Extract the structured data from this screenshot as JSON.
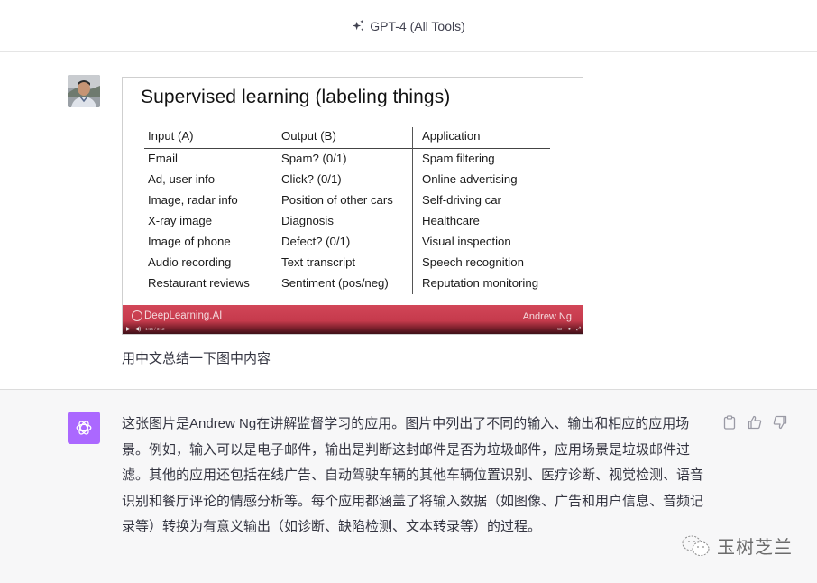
{
  "header": {
    "model_label": "GPT-4 (All Tools)"
  },
  "user_message": {
    "slide": {
      "title": "Supervised learning (labeling things)",
      "columns": {
        "input_header": "Input (A)",
        "output_header": "Output (B)",
        "application_header": "Application"
      },
      "rows": [
        {
          "input": "Email",
          "output": "Spam? (0/1)",
          "application": "Spam filtering"
        },
        {
          "input": "Ad, user info",
          "output": "Click? (0/1)",
          "application": "Online advertising"
        },
        {
          "input": "Image, radar info",
          "output": "Position of other cars",
          "application": "Self-driving car"
        },
        {
          "input": "X-ray image",
          "output": "Diagnosis",
          "application": "Healthcare"
        },
        {
          "input": "Image of phone",
          "output": "Defect? (0/1)",
          "application": "Visual inspection"
        },
        {
          "input": "Audio recording",
          "output": "Text transcript",
          "application": "Speech recognition"
        },
        {
          "input": "Restaurant reviews",
          "output": "Sentiment (pos/neg)",
          "application": "Reputation monitoring"
        }
      ],
      "footer_brand": "DeepLearning.AI",
      "footer_presenter": "Andrew Ng",
      "player_time": "1:15 / 3:12"
    },
    "prompt": "用中文总结一下图中内容"
  },
  "assistant_message": {
    "text": "这张图片是Andrew Ng在讲解监督学习的应用。图片中列出了不同的输入、输出和相应的应用场景。例如，输入可以是电子邮件，输出是判断这封邮件是否为垃圾邮件，应用场景是垃圾邮件过滤。其他的应用还包括在线广告、自动驾驶车辆的其他车辆位置识别、医疗诊断、视觉检测、语音识别和餐厅评论的情感分析等。每个应用都涵盖了将输入数据（如图像、广告和用户信息、音频记录等）转换为有意义输出（如诊断、缺陷检测、文本转录等）的过程。"
  },
  "watermark": {
    "text": "玉树芝兰"
  },
  "colors": {
    "gpt_avatar": "#ab68ff",
    "slide_footer": "#c53a4c",
    "assistant_bg": "#f7f7f8"
  }
}
